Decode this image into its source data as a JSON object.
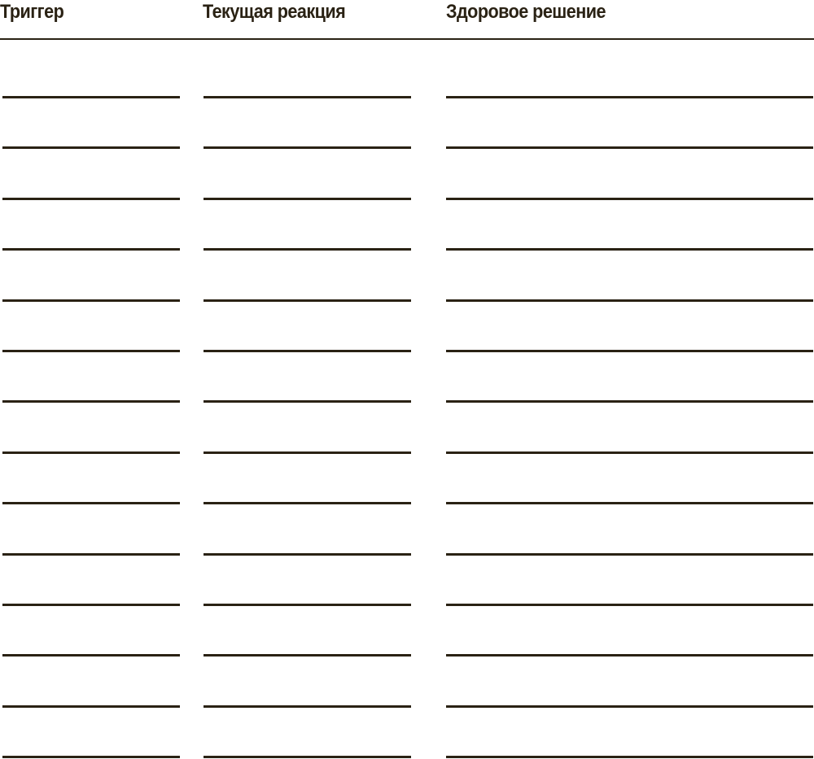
{
  "table": {
    "headers": [
      "Триггер",
      "Текущая реакция",
      "Здоровое решение"
    ],
    "rows": [
      [
        "",
        "",
        ""
      ],
      [
        "",
        "",
        ""
      ],
      [
        "",
        "",
        ""
      ],
      [
        "",
        "",
        ""
      ],
      [
        "",
        "",
        ""
      ],
      [
        "",
        "",
        ""
      ],
      [
        "",
        "",
        ""
      ],
      [
        "",
        "",
        ""
      ],
      [
        "",
        "",
        ""
      ],
      [
        "",
        "",
        ""
      ],
      [
        "",
        "",
        ""
      ],
      [
        "",
        "",
        ""
      ],
      [
        "",
        "",
        ""
      ],
      [
        "",
        "",
        ""
      ]
    ]
  },
  "colors": {
    "ink": "#2a2214",
    "background": "#ffffff"
  }
}
